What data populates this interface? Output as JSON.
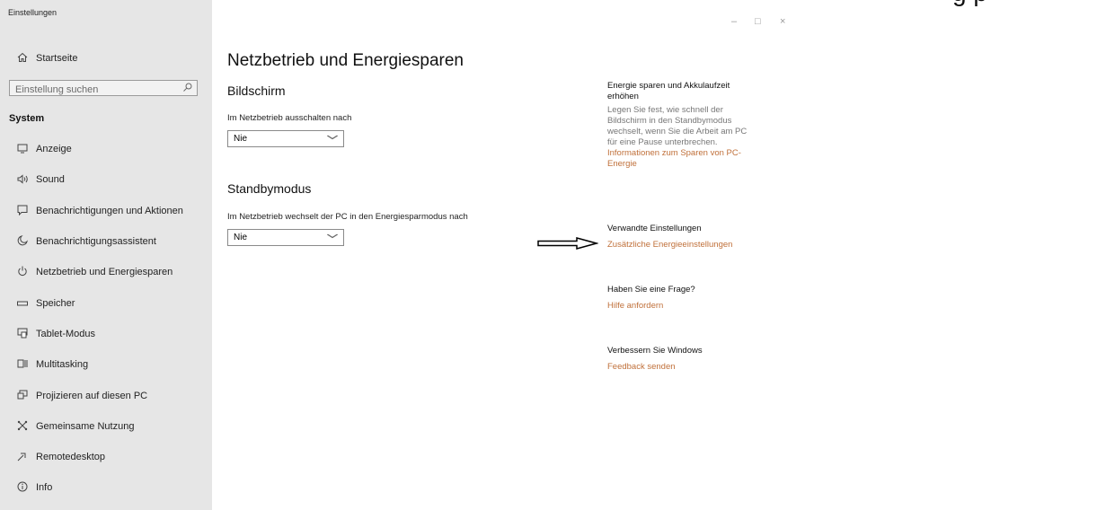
{
  "window": {
    "title": "Einstellungen",
    "minimize_glyph": "–",
    "maximize_glyph": "□",
    "close_glyph": "×"
  },
  "overlay_partial_text": "g p",
  "sidebar": {
    "home": {
      "label": "Startseite",
      "icon": "home-icon"
    },
    "search": {
      "placeholder": "Einstellung suchen",
      "icon": "search-icon"
    },
    "section": "System",
    "items": [
      {
        "label": "Anzeige",
        "icon": "display-icon"
      },
      {
        "label": "Sound",
        "icon": "speaker-icon"
      },
      {
        "label": "Benachrichtigungen und Aktionen",
        "icon": "notification-icon"
      },
      {
        "label": "Benachrichtigungsassistent",
        "icon": "moon-icon"
      },
      {
        "label": "Netzbetrieb und Energiesparen",
        "icon": "power-icon"
      },
      {
        "label": "Speicher",
        "icon": "storage-icon"
      },
      {
        "label": "Tablet-Modus",
        "icon": "tablet-icon"
      },
      {
        "label": "Multitasking",
        "icon": "multitasking-icon"
      },
      {
        "label": "Projizieren auf diesen PC",
        "icon": "project-icon"
      },
      {
        "label": "Gemeinsame Nutzung",
        "icon": "share-icon"
      },
      {
        "label": "Remotedesktop",
        "icon": "remote-icon"
      },
      {
        "label": "Info",
        "icon": "info-icon"
      }
    ]
  },
  "main": {
    "title": "Netzbetrieb und Energiesparen",
    "screen": {
      "heading": "Bildschirm",
      "label": "Im Netzbetrieb ausschalten nach",
      "value": "Nie"
    },
    "standby": {
      "heading": "Standbymodus",
      "label": "Im Netzbetrieb wechselt der PC in den Energiesparmodus nach",
      "value": "Nie"
    }
  },
  "right": {
    "save": {
      "heading_line1": "Energie sparen und Akkulaufzeit",
      "heading_line2": "erhöhen",
      "desc_lines": [
        "Legen Sie fest, wie schnell der",
        "Bildschirm in den Standbymodus",
        "wechselt, wenn Sie die Arbeit am PC",
        "für eine Pause unterbrechen."
      ],
      "link_line1": "Informationen zum Sparen von PC-",
      "link_line2": "Energie"
    },
    "related": {
      "heading": "Verwandte Einstellungen",
      "link": "Zusätzliche Energieeinstellungen"
    },
    "question": {
      "heading": "Haben Sie eine Frage?",
      "link": "Hilfe anfordern"
    },
    "improve": {
      "heading": "Verbessern Sie Windows",
      "link": "Feedback senden"
    }
  },
  "colors": {
    "sidebar_bg": "#e6e6e6",
    "link": "#c0703a",
    "secondary_text": "#777777"
  }
}
